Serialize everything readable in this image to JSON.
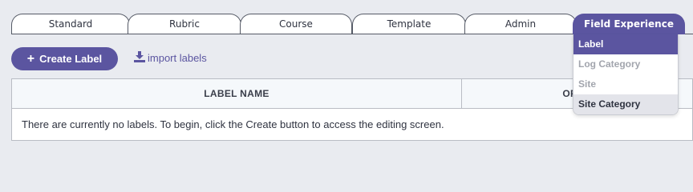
{
  "tabs": [
    {
      "label": "Standard"
    },
    {
      "label": "Rubric"
    },
    {
      "label": "Course"
    },
    {
      "label": "Template"
    },
    {
      "label": "Admin"
    },
    {
      "label": "Field Experience"
    }
  ],
  "dropdown": {
    "items": [
      {
        "label": "Label"
      },
      {
        "label": "Log Category"
      },
      {
        "label": "Site"
      },
      {
        "label": "Site Category"
      }
    ]
  },
  "toolbar": {
    "create_label": "Create Label",
    "import_label": "import labels"
  },
  "table": {
    "columns": [
      "LABEL NAME",
      "OPER"
    ],
    "empty_message": "There are currently no labels. To begin, click the Create button to access the editing screen."
  },
  "colors": {
    "accent": "#5b55a0",
    "background": "#e9ebf0"
  },
  "icons": {
    "create": "plus-icon",
    "import": "download-icon"
  }
}
